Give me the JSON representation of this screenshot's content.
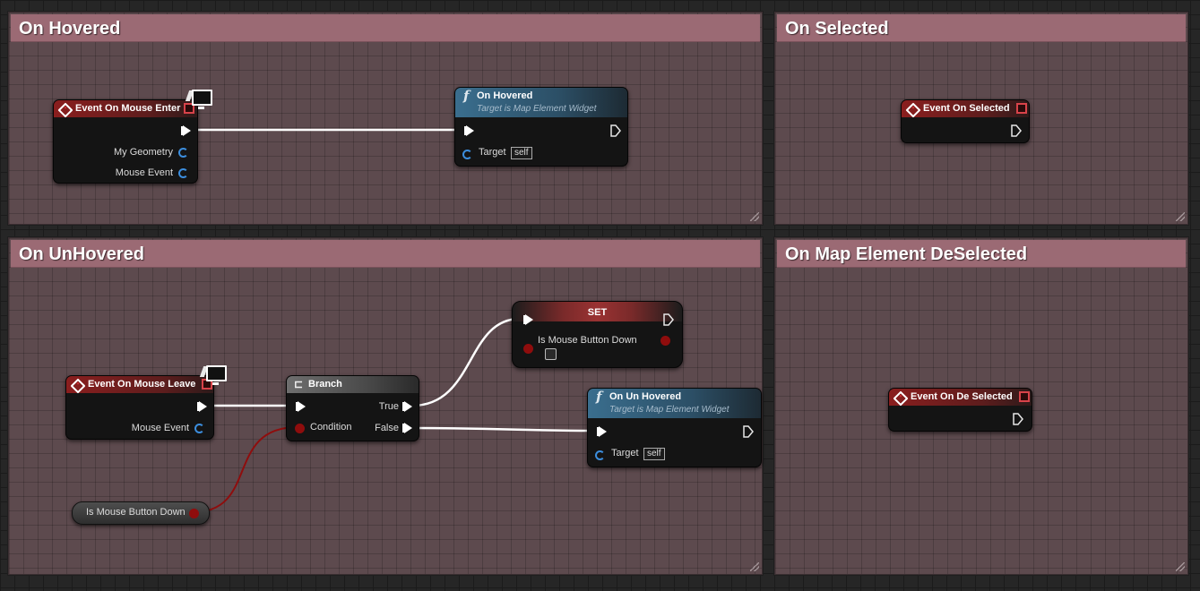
{
  "comments": [
    {
      "title": "On Hovered"
    },
    {
      "title": "On Selected"
    },
    {
      "title": "On UnHovered"
    },
    {
      "title": "On Map Element DeSelected"
    }
  ],
  "nodes": {
    "mouse_enter": {
      "title": "Event On Mouse Enter",
      "pins": [
        "My Geometry",
        "Mouse Event"
      ]
    },
    "on_hovered_call": {
      "title": "On Hovered",
      "subtitle": "Target is Map Element Widget",
      "target_label": "Target",
      "target_value": "self"
    },
    "event_selected": {
      "title": "Event On Selected"
    },
    "mouse_leave": {
      "title": "Event On Mouse Leave",
      "pins": [
        "Mouse Event"
      ]
    },
    "branch": {
      "title": "Branch",
      "condition": "Condition",
      "true_label": "True",
      "false_label": "False"
    },
    "set": {
      "title": "SET",
      "var_label": "Is Mouse Button Down"
    },
    "on_unhovered_call": {
      "title": "On Un Hovered",
      "subtitle": "Target is Map Element Widget",
      "target_label": "Target",
      "target_value": "self"
    },
    "getter": {
      "label": "Is Mouse Button Down"
    },
    "event_deselected": {
      "title": "Event On De Selected"
    }
  },
  "colors": {
    "comment_bg": "#5d4a4e",
    "comment_header": "#9b6a74",
    "event_header": "#8a1e1e",
    "function_header": "#3a6e8e",
    "exec_wire": "#ffffff",
    "bool_wire": "#8f0d0d",
    "struct_pin": "#3c8ede"
  },
  "icons": [
    "event-diamond-icon",
    "function-icon",
    "branch-icon",
    "delegate-pin-icon",
    "client-monitor-icon",
    "exec-pin-icon",
    "struct-pin-icon",
    "bool-pin-icon",
    "resize-grip-icon"
  ]
}
